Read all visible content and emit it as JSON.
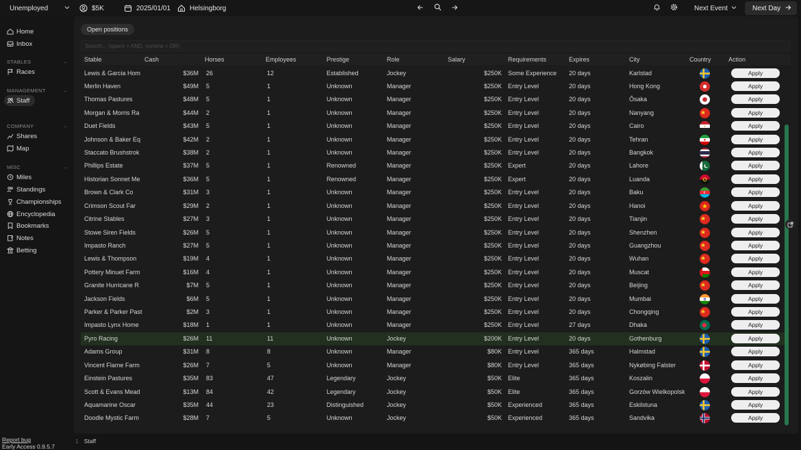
{
  "topbar": {
    "job": "Unemployed",
    "money": "$5K",
    "date": "2025/01/01",
    "home": "Helsingborg",
    "next_event": "Next Event",
    "next_day": "Next Day"
  },
  "sidebar": {
    "items_top": [
      {
        "label": "Home",
        "icon": "home-icon"
      },
      {
        "label": "Inbox",
        "icon": "inbox-icon"
      }
    ],
    "stables_head": "STABLES",
    "stables": [
      {
        "label": "Races",
        "icon": "flag-icon"
      }
    ],
    "management_head": "MANAGEMENT",
    "management": [
      {
        "label": "Staff",
        "icon": "users-icon",
        "active": true
      }
    ],
    "company_head": "COMPANY",
    "company": [
      {
        "label": "Shares",
        "icon": "shares-icon"
      },
      {
        "label": "Map",
        "icon": "map-icon"
      }
    ],
    "misc_head": "MISC",
    "misc": [
      {
        "label": "Miles",
        "icon": "miles-icon"
      },
      {
        "label": "Standings",
        "icon": "standings-icon"
      },
      {
        "label": "Championships",
        "icon": "trophy-icon"
      },
      {
        "label": "Encyclopedia",
        "icon": "globe-icon"
      },
      {
        "label": "Bookmarks",
        "icon": "bookmark-icon"
      },
      {
        "label": "Notes",
        "icon": "notes-icon"
      },
      {
        "label": "Betting",
        "icon": "betting-icon"
      }
    ],
    "report_bug": "Report bug",
    "version": "Early Access 0.9.5.7"
  },
  "main": {
    "open_positions": "Open positions",
    "search_placeholder": "Search... (space = AND, comma = OR)",
    "columns": [
      "Stable",
      "Cash",
      "Horses",
      "Employees",
      "Prestige",
      "Role",
      "Salary",
      "Requirements",
      "Expires",
      "City",
      "Country",
      "Action"
    ],
    "apply_label": "Apply",
    "rows": [
      {
        "stable": "Lewis & Garcia Hom",
        "cash": "$36M",
        "horses": "26",
        "employees": "12",
        "prestige": "Established",
        "role": "Jockey",
        "salary": "$250K",
        "req": "Some Experience",
        "expires": "20 days",
        "city": "Karlstad",
        "flag": "se"
      },
      {
        "stable": "Merlin Haven",
        "cash": "$49M",
        "horses": "5",
        "employees": "1",
        "prestige": "Unknown",
        "role": "Manager",
        "salary": "$250K",
        "req": "Entry Level",
        "expires": "20 days",
        "city": "Hong Kong",
        "flag": "hk"
      },
      {
        "stable": "Thomas Pastures",
        "cash": "$48M",
        "horses": "5",
        "employees": "1",
        "prestige": "Unknown",
        "role": "Manager",
        "salary": "$250K",
        "req": "Entry Level",
        "expires": "20 days",
        "city": "Ōsaka",
        "flag": "jp"
      },
      {
        "stable": "Morgan & Morris Ra",
        "cash": "$44M",
        "horses": "2",
        "employees": "1",
        "prestige": "Unknown",
        "role": "Manager",
        "salary": "$250K",
        "req": "Entry Level",
        "expires": "20 days",
        "city": "Nanyang",
        "flag": "cn"
      },
      {
        "stable": "Duet Fields",
        "cash": "$43M",
        "horses": "5",
        "employees": "1",
        "prestige": "Unknown",
        "role": "Manager",
        "salary": "$250K",
        "req": "Entry Level",
        "expires": "20 days",
        "city": "Cairo",
        "flag": "eg"
      },
      {
        "stable": "Johnson & Baker Eq",
        "cash": "$42M",
        "horses": "2",
        "employees": "1",
        "prestige": "Unknown",
        "role": "Manager",
        "salary": "$250K",
        "req": "Entry Level",
        "expires": "20 days",
        "city": "Tehran",
        "flag": "ir"
      },
      {
        "stable": "Staccato Brushstrok",
        "cash": "$38M",
        "horses": "2",
        "employees": "1",
        "prestige": "Unknown",
        "role": "Manager",
        "salary": "$250K",
        "req": "Entry Level",
        "expires": "20 days",
        "city": "Bangkok",
        "flag": "th"
      },
      {
        "stable": "Phillips Estate",
        "cash": "$37M",
        "horses": "5",
        "employees": "1",
        "prestige": "Renowned",
        "role": "Manager",
        "salary": "$250K",
        "req": "Expert",
        "expires": "20 days",
        "city": "Lahore",
        "flag": "pk"
      },
      {
        "stable": "Historian Sonnet Me",
        "cash": "$36M",
        "horses": "5",
        "employees": "1",
        "prestige": "Renowned",
        "role": "Manager",
        "salary": "$250K",
        "req": "Expert",
        "expires": "20 days",
        "city": "Luanda",
        "flag": "ao"
      },
      {
        "stable": "Brown & Clark Co",
        "cash": "$31M",
        "horses": "3",
        "employees": "1",
        "prestige": "Unknown",
        "role": "Manager",
        "salary": "$250K",
        "req": "Entry Level",
        "expires": "20 days",
        "city": "Baku",
        "flag": "az"
      },
      {
        "stable": "Crimson Scout Far",
        "cash": "$29M",
        "horses": "2",
        "employees": "1",
        "prestige": "Unknown",
        "role": "Manager",
        "salary": "$250K",
        "req": "Entry Level",
        "expires": "20 days",
        "city": "Hanoi",
        "flag": "vn"
      },
      {
        "stable": "Citrine Stables",
        "cash": "$27M",
        "horses": "3",
        "employees": "1",
        "prestige": "Unknown",
        "role": "Manager",
        "salary": "$250K",
        "req": "Entry Level",
        "expires": "20 days",
        "city": "Tianjin",
        "flag": "cn"
      },
      {
        "stable": "Stowe Siren Fields",
        "cash": "$26M",
        "horses": "5",
        "employees": "1",
        "prestige": "Unknown",
        "role": "Manager",
        "salary": "$250K",
        "req": "Entry Level",
        "expires": "20 days",
        "city": "Shenzhen",
        "flag": "cn"
      },
      {
        "stable": "Impasto Ranch",
        "cash": "$27M",
        "horses": "5",
        "employees": "1",
        "prestige": "Unknown",
        "role": "Manager",
        "salary": "$250K",
        "req": "Entry Level",
        "expires": "20 days",
        "city": "Guangzhou",
        "flag": "cn"
      },
      {
        "stable": "Lewis & Thompson",
        "cash": "$19M",
        "horses": "4",
        "employees": "1",
        "prestige": "Unknown",
        "role": "Manager",
        "salary": "$250K",
        "req": "Entry Level",
        "expires": "20 days",
        "city": "Wuhan",
        "flag": "cn"
      },
      {
        "stable": "Pottery Minuet Farm",
        "cash": "$16M",
        "horses": "4",
        "employees": "1",
        "prestige": "Unknown",
        "role": "Manager",
        "salary": "$250K",
        "req": "Entry Level",
        "expires": "20 days",
        "city": "Muscat",
        "flag": "om"
      },
      {
        "stable": "Granite Hurricane R",
        "cash": "$7M",
        "horses": "5",
        "employees": "1",
        "prestige": "Unknown",
        "role": "Manager",
        "salary": "$250K",
        "req": "Entry Level",
        "expires": "20 days",
        "city": "Beijing",
        "flag": "cn"
      },
      {
        "stable": "Jackson Fields",
        "cash": "$6M",
        "horses": "5",
        "employees": "1",
        "prestige": "Unknown",
        "role": "Manager",
        "salary": "$250K",
        "req": "Entry Level",
        "expires": "20 days",
        "city": "Mumbai",
        "flag": "in"
      },
      {
        "stable": "Parker & Parker Past",
        "cash": "$2M",
        "horses": "3",
        "employees": "1",
        "prestige": "Unknown",
        "role": "Manager",
        "salary": "$250K",
        "req": "Entry Level",
        "expires": "20 days",
        "city": "Chongqing",
        "flag": "cn"
      },
      {
        "stable": "Impasto Lynx Home",
        "cash": "$18M",
        "horses": "1",
        "employees": "1",
        "prestige": "Unknown",
        "role": "Manager",
        "salary": "$250K",
        "req": "Entry Level",
        "expires": "27 days",
        "city": "Dhaka",
        "flag": "bd"
      },
      {
        "stable": "Pyro Racing",
        "cash": "$26M",
        "horses": "11",
        "employees": "11",
        "prestige": "Unknown",
        "role": "Jockey",
        "salary": "$200K",
        "req": "Entry Level",
        "expires": "20 days",
        "city": "Gothenburg",
        "flag": "se",
        "highlight": true
      },
      {
        "stable": "Adams Group",
        "cash": "$31M",
        "horses": "8",
        "employees": "8",
        "prestige": "Unknown",
        "role": "Manager",
        "salary": "$80K",
        "req": "Entry Level",
        "expires": "365 days",
        "city": "Halmstad",
        "flag": "se"
      },
      {
        "stable": "Vincent Flame Farm",
        "cash": "$26M",
        "horses": "7",
        "employees": "5",
        "prestige": "Unknown",
        "role": "Manager",
        "salary": "$80K",
        "req": "Entry Level",
        "expires": "365 days",
        "city": "Nykøbing Falster",
        "flag": "dk"
      },
      {
        "stable": "Einstein Pastures",
        "cash": "$35M",
        "horses": "83",
        "employees": "47",
        "prestige": "Legendary",
        "role": "Jockey",
        "salary": "$50K",
        "req": "Elite",
        "expires": "365 days",
        "city": "Koszalin",
        "flag": "pl"
      },
      {
        "stable": "Scott & Evans Mead",
        "cash": "$13M",
        "horses": "84",
        "employees": "42",
        "prestige": "Legendary",
        "role": "Jockey",
        "salary": "$50K",
        "req": "Elite",
        "expires": "365 days",
        "city": "Gorzów Wielkopolsk",
        "flag": "pl"
      },
      {
        "stable": "Aquamarine Oscar",
        "cash": "$35M",
        "horses": "44",
        "employees": "23",
        "prestige": "Distinguished",
        "role": "Jockey",
        "salary": "$50K",
        "req": "Experienced",
        "expires": "365 days",
        "city": "Eskilstuna",
        "flag": "se"
      },
      {
        "stable": "Doodle Mystic Farm",
        "cash": "$28M",
        "horses": "7",
        "employees": "5",
        "prestige": "Unknown",
        "role": "Jockey",
        "salary": "$50K",
        "req": "Experienced",
        "expires": "365 days",
        "city": "Sandvika",
        "flag": "no"
      }
    ]
  },
  "footer": {
    "tab_num": "1",
    "tab_label": "Staff"
  }
}
